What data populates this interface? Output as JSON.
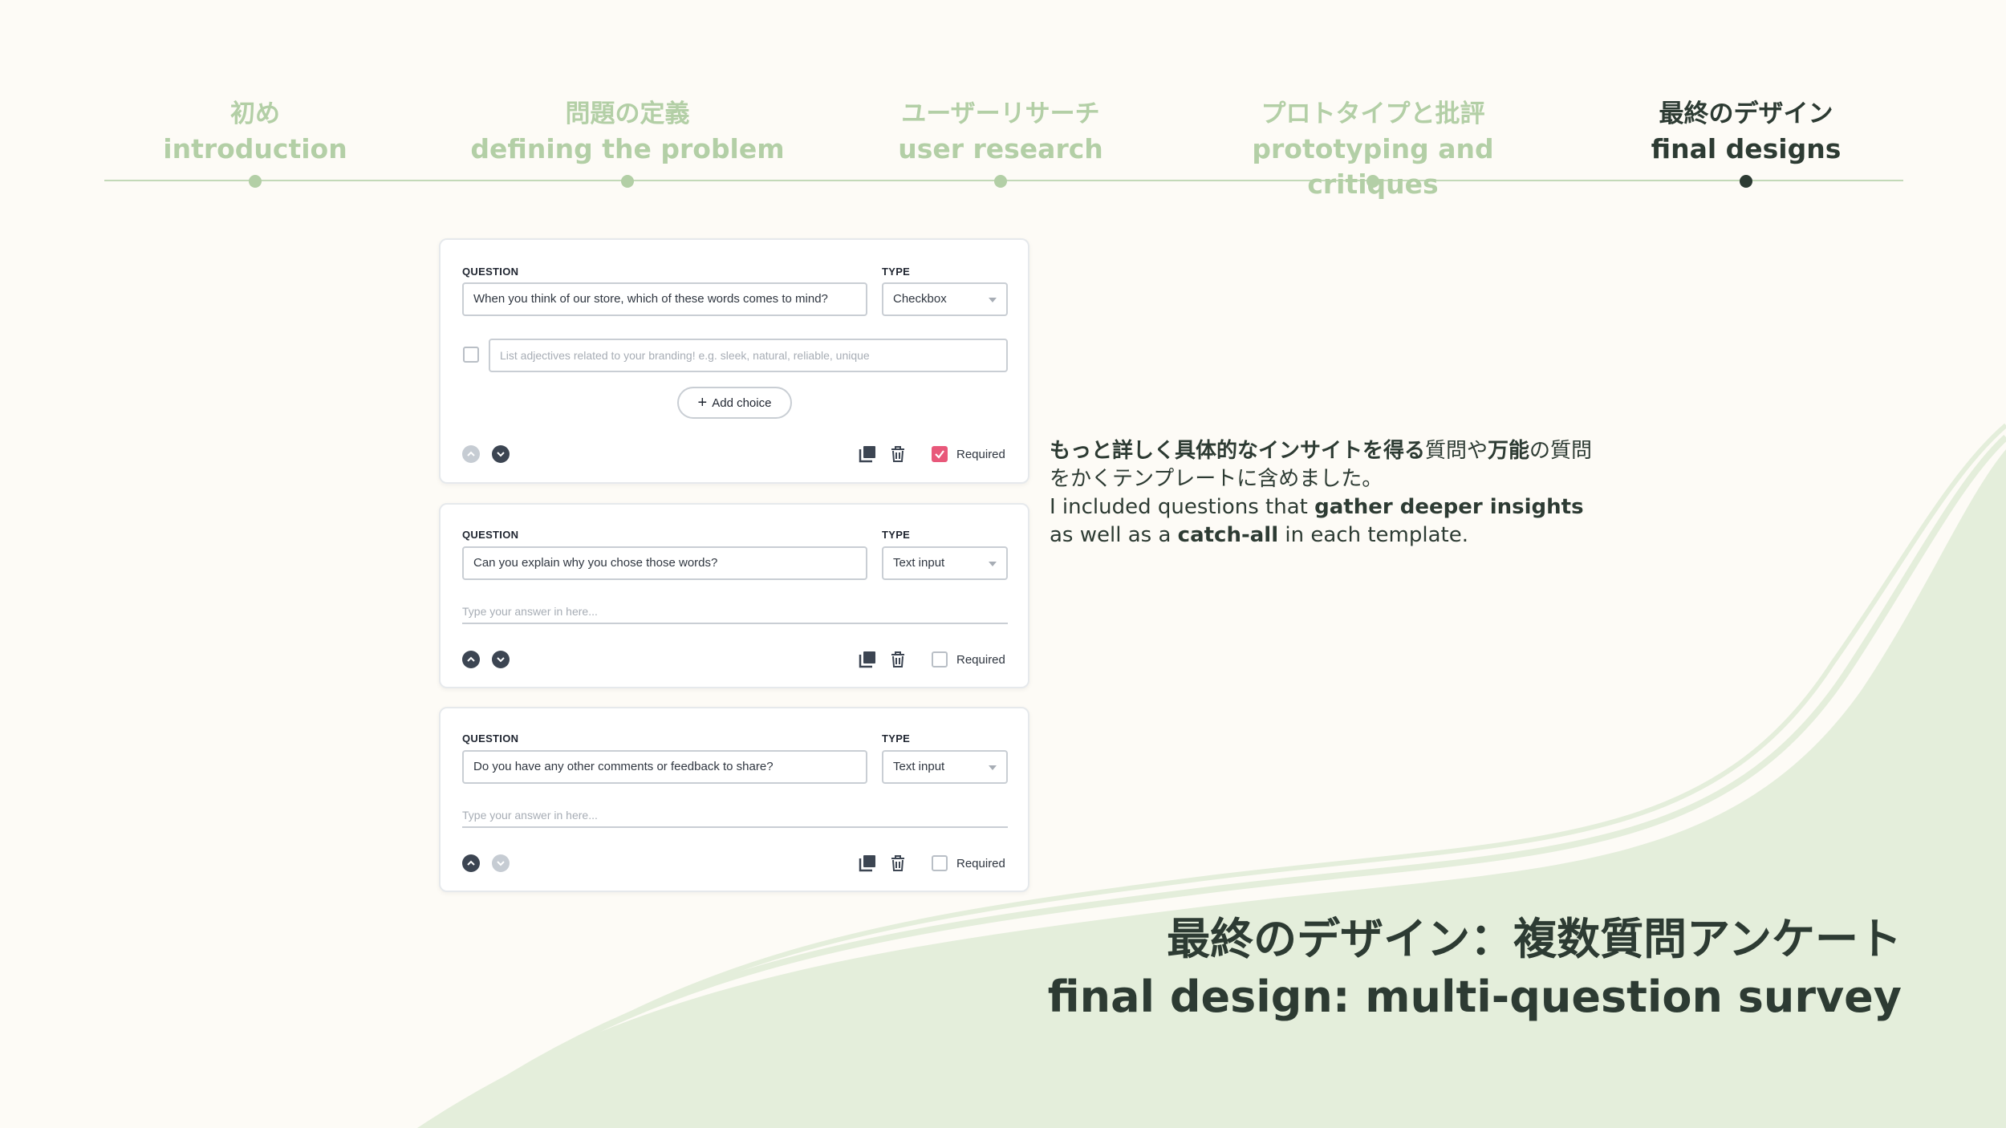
{
  "timeline": {
    "steps": [
      {
        "jp": "初め",
        "en": "introduction"
      },
      {
        "jp": "問題の定義",
        "en": "defining the problem"
      },
      {
        "jp": "ユーザーリサーチ",
        "en": "user research"
      },
      {
        "jp": "プロトタイプと批評",
        "en": "prototyping and critiques"
      },
      {
        "jp": "最終のデザイン",
        "en": "final designs"
      }
    ],
    "active_index": 4
  },
  "survey": {
    "question_label": "QUESTION",
    "type_label": "TYPE",
    "required_label": "Required",
    "cards": [
      {
        "question": "When you think of our store, which of these words comes to mind?",
        "type": "Checkbox",
        "choice_placeholder": "List adjectives related to your branding! e.g. sleek, natural, reliable, unique",
        "add_choice": "Add choice",
        "required": true
      },
      {
        "question": "Can you explain why you chose those words?",
        "type": "Text input",
        "answer_placeholder": "Type your answer in here...",
        "required": false
      },
      {
        "question": "Do you have any other comments or feedback to share?",
        "type": "Text input",
        "answer_placeholder": "Type your answer in here...",
        "required": false
      }
    ]
  },
  "description": {
    "jp_bold_1": "もっと詳しく具体的なインサイトを得る",
    "jp_1": "質問や",
    "jp_bold_2": "万能",
    "jp_2": "の質問をかくテンプレートに含めました。",
    "en_1": "I included questions that ",
    "en_bold_1": "gather deeper insights",
    "en_2": " as well as a ",
    "en_bold_2": "catch-all",
    "en_3": " in each template."
  },
  "title": {
    "jp": "最終のデザイン：複数質問アンケート",
    "en": "final design: multi-question survey"
  },
  "colors": {
    "background": "#fdfbf6",
    "wave": "#e4eedb",
    "timeline_inactive": "#b3cfa6",
    "timeline_active": "#2d3b33",
    "required_checked": "#e8587a"
  }
}
